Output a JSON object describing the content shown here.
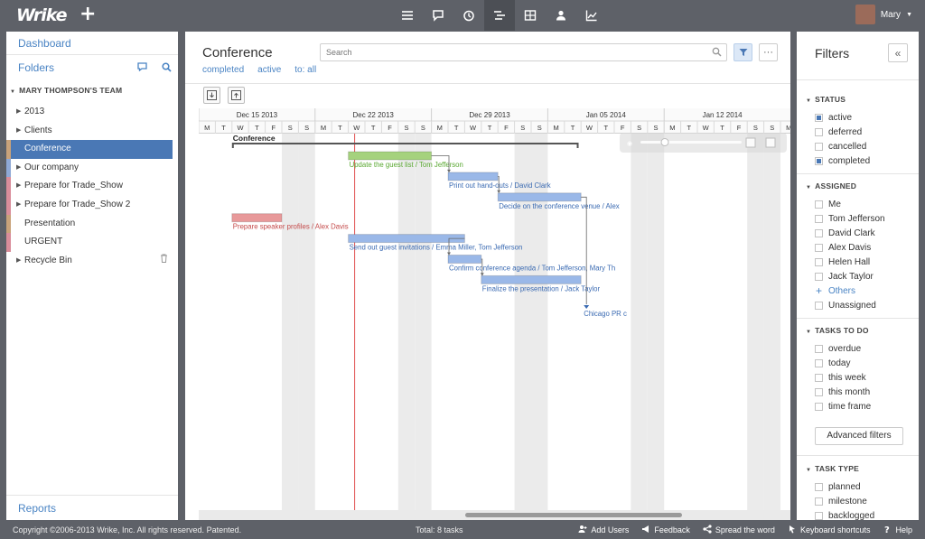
{
  "app": {
    "logo": "Wrike",
    "add_symbol": "+"
  },
  "topnav": {
    "icons": [
      "list-icon",
      "stream-icon",
      "timelog-icon",
      "timeline-icon",
      "table-icon",
      "workload-icon",
      "reports-icon"
    ],
    "active": "timeline-icon"
  },
  "user": {
    "name": "Mary"
  },
  "left": {
    "dashboard": "Dashboard",
    "folders": "Folders",
    "team": "MARY THOMPSON'S TEAM",
    "tree": [
      {
        "label": "2013",
        "arrow": true,
        "swatch": ""
      },
      {
        "label": "Clients",
        "arrow": true,
        "swatch": ""
      },
      {
        "label": "Conference",
        "arrow": false,
        "swatch": "#c9a27a",
        "selected": true
      },
      {
        "label": "Our company",
        "arrow": true,
        "swatch": "#8fa9d6"
      },
      {
        "label": "Prepare for Trade_Show",
        "arrow": true,
        "swatch": "#d98d9a"
      },
      {
        "label": "Prepare for Trade_Show 2",
        "arrow": true,
        "swatch": "#d98d9a"
      },
      {
        "label": "Presentation",
        "arrow": false,
        "swatch": "#c9a27a"
      },
      {
        "label": "URGENT",
        "arrow": false,
        "swatch": "#d98d9a"
      },
      {
        "label": "Recycle Bin",
        "arrow": true,
        "swatch": "",
        "trash": true
      }
    ],
    "reports": "Reports"
  },
  "center": {
    "title": "Conference",
    "subfilters": [
      "completed",
      "active",
      "to: all"
    ],
    "search_placeholder": "Search",
    "more_label": "···"
  },
  "chart_data": {
    "type": "gantt",
    "weeks": [
      "Dec 15 2013",
      "Dec 22 2013",
      "Dec 29 2013",
      "Jan 05 2014",
      "Jan 12 2014"
    ],
    "day_letters": [
      "M",
      "T",
      "W",
      "T",
      "F",
      "S",
      "S"
    ],
    "first_day": "2013-12-16",
    "today": "2013-12-25",
    "project": {
      "name": "Conference",
      "start": "2013-12-18",
      "end": "2014-01-07"
    },
    "tasks": [
      {
        "label": "Update the guest list / Tom Jefferson",
        "start": "2013-12-25",
        "end": "2013-12-30",
        "color": "#a5d27d",
        "text_color": "#5aa832"
      },
      {
        "label": "Print out hand-outs / David Clark",
        "start": "2013-12-31",
        "end": "2014-01-03",
        "color": "#9ab8e8",
        "text_color": "#3a6ab2"
      },
      {
        "label": "Decide on the conference venue / Alex",
        "start": "2014-01-03",
        "end": "2014-01-08",
        "color": "#9ab8e8",
        "text_color": "#3a6ab2"
      },
      {
        "label": "Prepare speaker profiles / Alex Davis",
        "start": "2013-12-18",
        "end": "2013-12-21",
        "color": "#e8999a",
        "text_color": "#c44a4a"
      },
      {
        "label": "Send out guest invitations / Emma Miller, Tom Jefferson",
        "start": "2013-12-25",
        "end": "2014-01-01",
        "color": "#9ab8e8",
        "text_color": "#3a6ab2"
      },
      {
        "label": "Confirm conference agenda / Tom Jefferson, Mary Th",
        "start": "2013-12-31",
        "end": "2014-01-02",
        "color": "#9ab8e8",
        "text_color": "#3a6ab2"
      },
      {
        "label": "Finalize the presentation / Jack Taylor",
        "start": "2014-01-02",
        "end": "2014-01-08",
        "color": "#9ab8e8",
        "text_color": "#3a6ab2"
      }
    ],
    "milestones": [
      {
        "label": "Chicago PR c",
        "date": "2014-01-08"
      }
    ]
  },
  "filters": {
    "title": "Filters",
    "status": {
      "header": "STATUS",
      "options": [
        {
          "label": "active",
          "checked": true
        },
        {
          "label": "deferred",
          "checked": false
        },
        {
          "label": "cancelled",
          "checked": false
        },
        {
          "label": "completed",
          "checked": true
        }
      ]
    },
    "assigned": {
      "header": "ASSIGNED",
      "options": [
        {
          "label": "Me",
          "checked": false
        },
        {
          "label": "Tom Jefferson",
          "checked": false
        },
        {
          "label": "David Clark",
          "checked": false
        },
        {
          "label": "Alex Davis",
          "checked": false
        },
        {
          "label": "Helen Hall",
          "checked": false
        },
        {
          "label": "Jack Taylor",
          "checked": false
        }
      ],
      "others": "Others",
      "unassigned": "Unassigned"
    },
    "todo": {
      "header": "TASKS TO DO",
      "options": [
        "overdue",
        "today",
        "this week",
        "this month",
        "time frame"
      ]
    },
    "advanced": "Advanced filters",
    "task_type": {
      "header": "TASK TYPE",
      "options": [
        "planned",
        "milestone",
        "backlogged"
      ]
    }
  },
  "footer": {
    "copyright": "Copyright ©2006-2013 Wrike, Inc. All rights reserved. Patented.",
    "total": "Total: 8 tasks",
    "links": [
      {
        "label": "Add Users",
        "icon": "add-users-icon"
      },
      {
        "label": "Feedback",
        "icon": "megaphone-icon"
      },
      {
        "label": "Spread the word",
        "icon": "share-icon"
      },
      {
        "label": "Keyboard shortcuts",
        "icon": "keyboard-icon"
      },
      {
        "label": "Help",
        "icon": "help-icon"
      }
    ]
  }
}
